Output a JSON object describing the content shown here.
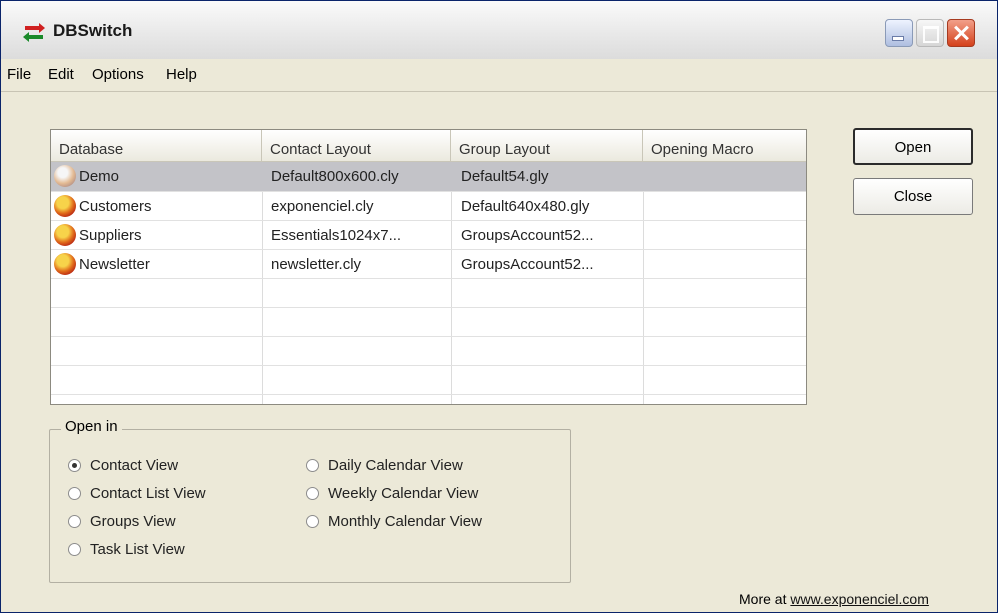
{
  "window": {
    "title": "DBSwitch"
  },
  "menu": [
    "File",
    "Edit",
    "Options",
    "Help"
  ],
  "table": {
    "columns": [
      "Database",
      "Contact Layout",
      "Group Layout",
      "Opening Macro"
    ],
    "rows": [
      {
        "database": "Demo",
        "contact_layout": "Default800x600.cly",
        "group_layout": "Default54.gly",
        "opening_macro": ""
      },
      {
        "database": "Customers",
        "contact_layout": "exponenciel.cly",
        "group_layout": "Default640x480.gly",
        "opening_macro": ""
      },
      {
        "database": "Suppliers",
        "contact_layout": "Essentials1024x7...",
        "group_layout": "GroupsAccount52...",
        "opening_macro": ""
      },
      {
        "database": "Newsletter",
        "contact_layout": "newsletter.cly",
        "group_layout": "GroupsAccount52...",
        "opening_macro": ""
      }
    ],
    "selected_row": 0
  },
  "buttons": {
    "open": "Open",
    "close": "Close"
  },
  "open_in": {
    "label": "Open in",
    "options": [
      {
        "label": "Contact View",
        "checked": true
      },
      {
        "label": "Contact List View",
        "checked": false
      },
      {
        "label": "Groups View",
        "checked": false
      },
      {
        "label": "Task List View",
        "checked": false
      },
      {
        "label": "Daily Calendar View",
        "checked": false
      },
      {
        "label": "Weekly Calendar View",
        "checked": false
      },
      {
        "label": "Monthly Calendar View",
        "checked": false
      }
    ]
  },
  "footer": {
    "more_text": "More at",
    "link_text": "www.exponenciel.com"
  },
  "icons": {
    "app": "arrows-switch-icon",
    "database": "database-icon"
  },
  "colors": {
    "accent": "#c3c3c8",
    "close": "#d4411c"
  }
}
